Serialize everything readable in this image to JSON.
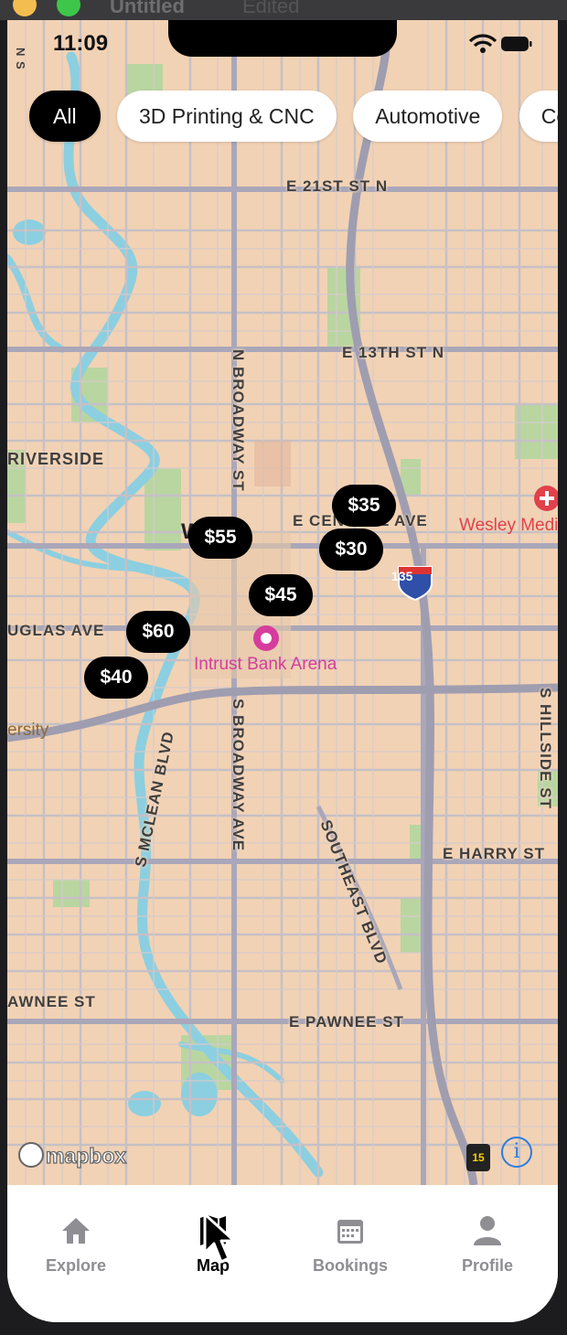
{
  "window": {
    "title": "Untitled",
    "subtitle": "Edited"
  },
  "status_bar": {
    "time": "11:09"
  },
  "categories": [
    {
      "label": "All",
      "active": true
    },
    {
      "label": "3D Printing & CNC",
      "active": false
    },
    {
      "label": "Automotive",
      "active": false
    },
    {
      "label": "Cer",
      "active": false
    }
  ],
  "map": {
    "streets": {
      "e21st": "E 21ST ST N",
      "e13th": "E 13TH ST N",
      "n_broadway": "N BROADWAY ST",
      "s_broadway": "S BROADWAY AVE",
      "central": "E CENTRAL AVE",
      "douglas": "UGLAS AVE",
      "smclean": "S MCLEAN BLVD",
      "southeast": "SOUTHEAST BLVD",
      "harry": "E HARRY ST",
      "pawnee_e": "E PAWNEE ST",
      "pawnee_w": "AWNEE ST",
      "hillside": "S HILLSIDE ST",
      "riverside": "RIVERSIDE",
      "nside": "N S"
    },
    "pois": {
      "arena": "Intrust Bank Arena",
      "wesley": "Wesley Medi",
      "university": "ersity",
      "city": "Wa"
    },
    "interstate": "135",
    "route15": "15",
    "attribution": "mapbox",
    "pins": [
      "$35",
      "$30",
      "$55",
      "$45",
      "$60",
      "$40"
    ]
  },
  "tabs": [
    {
      "label": "Explore",
      "icon": "home-icon",
      "active": false
    },
    {
      "label": "Map",
      "icon": "map-icon",
      "active": true
    },
    {
      "label": "Bookings",
      "icon": "calendar-icon",
      "active": false
    },
    {
      "label": "Profile",
      "icon": "person-icon",
      "active": false
    }
  ],
  "colors": {
    "map_land": "#f2d2b4",
    "road": "#b8b6c4",
    "park": "#b9d6a0",
    "water": "#8ccfe0",
    "pin_bg": "#000000",
    "arena_pink": "#d63d9c",
    "hospital_red": "#e0414b"
  }
}
